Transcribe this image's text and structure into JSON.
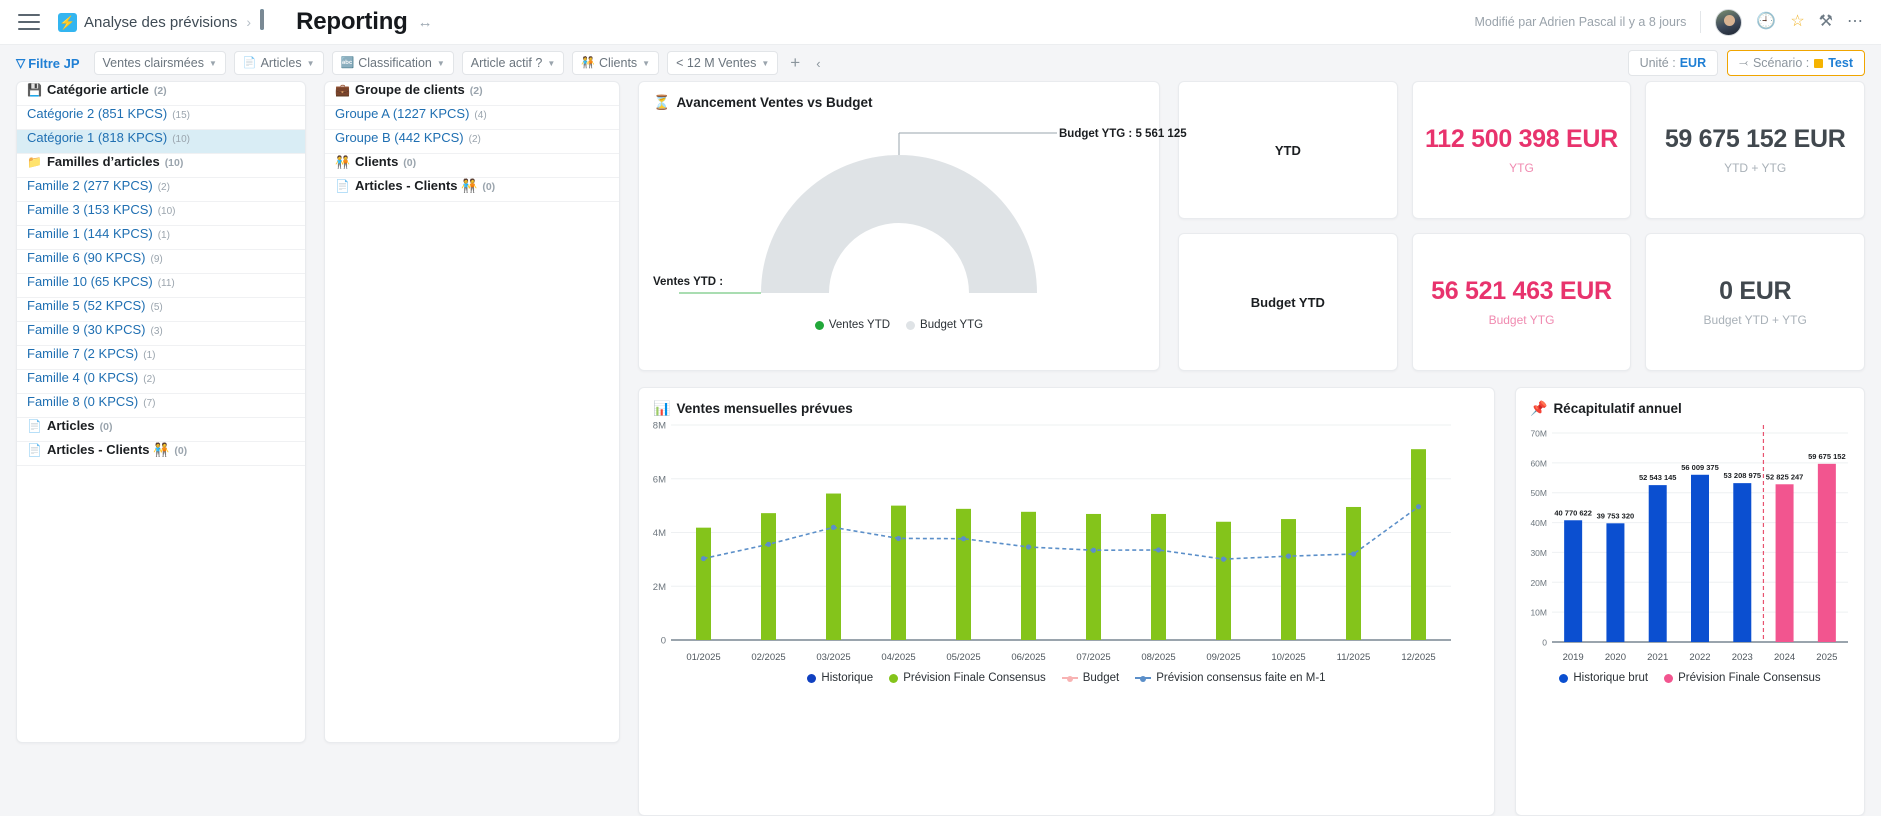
{
  "header": {
    "breadcrumb_app": "Analyse des prévisions",
    "page_title": "Reporting",
    "modified": "Modifié par Adrien Pascal il y a 8 jours"
  },
  "filterbar": {
    "label": "Filtre JP",
    "chips": [
      {
        "label": "Ventes clairsmées",
        "glyph": ""
      },
      {
        "label": "Articles",
        "glyph": "📄"
      },
      {
        "label": "Classification",
        "glyph": "🔤"
      },
      {
        "label": "Article actif ?",
        "glyph": ""
      },
      {
        "label": "Clients",
        "glyph": "🧑‍🤝‍🧑"
      },
      {
        "label": "< 12 M Ventes",
        "glyph": ""
      }
    ],
    "add_label": "+",
    "collapse_label": "‹",
    "unit_prefix": "Unité :",
    "unit_value": "EUR",
    "scenario_prefix": "Scénario :",
    "scenario_value": "Test"
  },
  "tree_left": [
    {
      "type": "group",
      "icon": "💾",
      "label": "Catégorie article",
      "count": "(2)"
    },
    {
      "type": "leaf",
      "label": "Catégorie 2 (851 KPCS)",
      "sup": "(15)"
    },
    {
      "type": "leaf",
      "selected": true,
      "label": "Catégorie 1 (818 KPCS)",
      "sup": "(10)"
    },
    {
      "type": "group",
      "icon": "📁",
      "label": "Familles d’articles",
      "count": "(10)"
    },
    {
      "type": "leaf",
      "label": "Famille 2 (277 KPCS)",
      "sup": "(2)"
    },
    {
      "type": "leaf",
      "label": "Famille 3 (153 KPCS)",
      "sup": "(10)"
    },
    {
      "type": "leaf",
      "label": "Famille 1 (144 KPCS)",
      "sup": "(1)"
    },
    {
      "type": "leaf",
      "label": "Famille 6 (90 KPCS)",
      "sup": "(9)"
    },
    {
      "type": "leaf",
      "label": "Famille 10 (65 KPCS)",
      "sup": "(11)"
    },
    {
      "type": "leaf",
      "label": "Famille 5 (52 KPCS)",
      "sup": "(5)"
    },
    {
      "type": "leaf",
      "label": "Famille 9 (30 KPCS)",
      "sup": "(3)"
    },
    {
      "type": "leaf",
      "label": "Famille 7 (2 KPCS)",
      "sup": "(1)"
    },
    {
      "type": "leaf",
      "label": "Famille 4 (0 KPCS)",
      "sup": "(2)"
    },
    {
      "type": "leaf",
      "label": "Famille 8 (0 KPCS)",
      "sup": "(7)"
    },
    {
      "type": "group",
      "icon": "📄",
      "label": "Articles",
      "count": "(0)"
    },
    {
      "type": "group",
      "icon": "📄",
      "label": "Articles - Clients 🧑‍🤝‍🧑",
      "count": "(0)"
    }
  ],
  "tree_right": [
    {
      "type": "group",
      "icon": "💼",
      "label": "Groupe de clients",
      "count": "(2)"
    },
    {
      "type": "leaf",
      "label": "Groupe A (1227 KPCS)",
      "sup": "(4)"
    },
    {
      "type": "leaf",
      "label": "Groupe B (442 KPCS)",
      "sup": "(2)"
    },
    {
      "type": "group",
      "icon": "🧑‍🤝‍🧑",
      "label": "Clients",
      "count": "(0)"
    },
    {
      "type": "group",
      "icon": "📄",
      "label": "Articles - Clients 🧑‍🤝‍🧑",
      "count": "(0)"
    }
  ],
  "gauge": {
    "title": "Avancement Ventes vs Budget",
    "title_icon": "⏳",
    "callout_budget": "Budget YTG : 5 561 125",
    "callout_ventes": "Ventes YTD :",
    "legend": [
      {
        "label": "Ventes YTD",
        "color": "#22a83a"
      },
      {
        "label": "Budget YTG",
        "color": "#dfe3e6"
      }
    ]
  },
  "kpis": [
    {
      "name": "ytd",
      "label": "YTD",
      "value": "",
      "sub": ""
    },
    {
      "name": "ytg",
      "label": "",
      "value": "112 500 398 EUR",
      "sub": "YTG",
      "tone": "pink"
    },
    {
      "name": "ytd-plus-ytg",
      "label": "",
      "value": "59 675 152 EUR",
      "sub": "YTD + YTG",
      "tone": "dark"
    },
    {
      "name": "budget-ytd",
      "label": "Budget YTD",
      "value": "",
      "sub": ""
    },
    {
      "name": "budget-ytg",
      "label": "",
      "value": "56 521 463 EUR",
      "sub": "Budget YTG",
      "tone": "pink"
    },
    {
      "name": "budget-total",
      "label": "",
      "value": "0 EUR",
      "sub": "Budget YTD + YTG",
      "tone": "dark"
    }
  ],
  "chart_data": [
    {
      "name": "monthly",
      "type": "bar",
      "title": "Ventes mensuelles prévues",
      "title_icon": "📊",
      "categories": [
        "01/2025",
        "02/2025",
        "03/2025",
        "04/2025",
        "05/2025",
        "06/2025",
        "07/2025",
        "08/2025",
        "09/2025",
        "10/2025",
        "11/2025",
        "12/2025"
      ],
      "ylim": [
        0,
        8000000
      ],
      "yticks": [
        "0",
        "2M",
        "4M",
        "6M",
        "8M"
      ],
      "ylabel": "",
      "xlabel": "",
      "grid": true,
      "series": [
        {
          "name": "Historique",
          "color": "#1040c0",
          "type": "bar",
          "values": [
            0,
            0,
            0,
            0,
            0,
            0,
            0,
            0,
            0,
            0,
            0,
            0
          ]
        },
        {
          "name": "Prévision Finale Consensus",
          "color": "#84c41b",
          "type": "bar",
          "values": [
            4180000,
            4720000,
            5450000,
            5000000,
            4880000,
            4770000,
            4690000,
            4690000,
            4400000,
            4500000,
            4950000,
            7100000
          ]
        },
        {
          "name": "Budget",
          "color": "#f8b3b3",
          "type": "line",
          "values": [
            null,
            null,
            null,
            null,
            null,
            null,
            null,
            null,
            null,
            null,
            null,
            null
          ]
        },
        {
          "name": "Prévision consensus faite en M-1",
          "color": "#5b8fc9",
          "type": "line",
          "values": [
            3030000,
            3560000,
            4190000,
            3780000,
            3770000,
            3460000,
            3340000,
            3350000,
            3010000,
            3120000,
            3200000,
            4960000
          ]
        }
      ],
      "legend_position": "bottom"
    },
    {
      "name": "annual",
      "type": "bar",
      "title": "Récapitulatif annuel",
      "title_icon": "📌",
      "categories": [
        "2019",
        "2020",
        "2021",
        "2022",
        "2023",
        "2024",
        "2025"
      ],
      "ylim": [
        0,
        70000000
      ],
      "yticks": [
        "0",
        "10M",
        "20M",
        "30M",
        "40M",
        "50M",
        "60M",
        "70M"
      ],
      "ylabel": "",
      "xlabel": "",
      "grid": true,
      "values": [
        40770622,
        39753320,
        52543145,
        56009375,
        53208975,
        52825247,
        59675152
      ],
      "value_labels": [
        "40 770 622",
        "39 753 320",
        "52 543 145",
        "56 009 375",
        "53 208 975",
        "52 825 247",
        "59 675 152"
      ],
      "bar_colors": [
        "#0b4fd0",
        "#0b4fd0",
        "#0b4fd0",
        "#0b4fd0",
        "#0b4fd0",
        "#f2558f",
        "#f2558f"
      ],
      "divider_after_category": "2023",
      "legend": [
        {
          "label": "Historique brut",
          "color": "#0b4fd0"
        },
        {
          "label": "Prévision Finale Consensus",
          "color": "#f2558f"
        }
      ],
      "legend_position": "bottom"
    }
  ]
}
